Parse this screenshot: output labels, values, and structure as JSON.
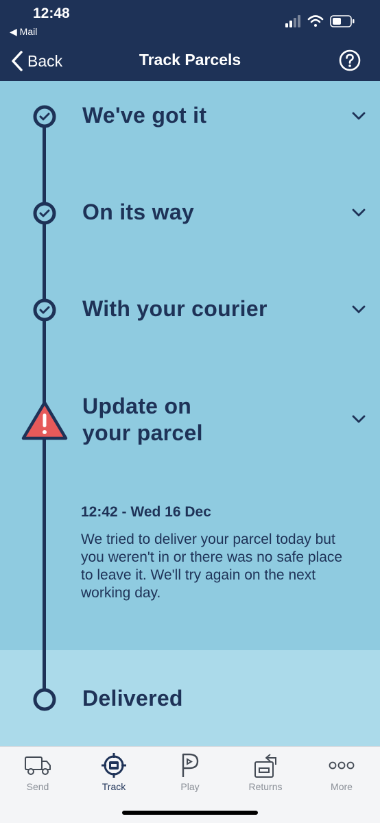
{
  "status": {
    "time": "12:48",
    "back_app": "Mail"
  },
  "nav": {
    "back_label": "Back",
    "title": "Track Parcels"
  },
  "steps": [
    {
      "title": "We've got it",
      "state": "done"
    },
    {
      "title": "On its way",
      "state": "done"
    },
    {
      "title": "With your courier",
      "state": "done"
    },
    {
      "title_line1": "Update on",
      "title_line2": "your parcel",
      "state": "alert"
    },
    {
      "title": "Delivered",
      "state": "pending"
    }
  ],
  "update": {
    "timestamp": "12:42 - Wed 16 Dec",
    "message": "We tried to deliver your parcel today but you weren't in or there was no safe place to leave it. We'll try again on the next working day."
  },
  "tabs": [
    {
      "label": "Send",
      "icon": "van-icon"
    },
    {
      "label": "Track",
      "icon": "target-icon",
      "active": true
    },
    {
      "label": "Play",
      "icon": "play-p-icon"
    },
    {
      "label": "Returns",
      "icon": "returns-icon"
    },
    {
      "label": "More",
      "icon": "more-dots-icon"
    }
  ],
  "colors": {
    "navy": "#1e3257",
    "sky": "#8fcbe0",
    "sky_light": "#abdaea",
    "alert": "#e65a5a"
  }
}
